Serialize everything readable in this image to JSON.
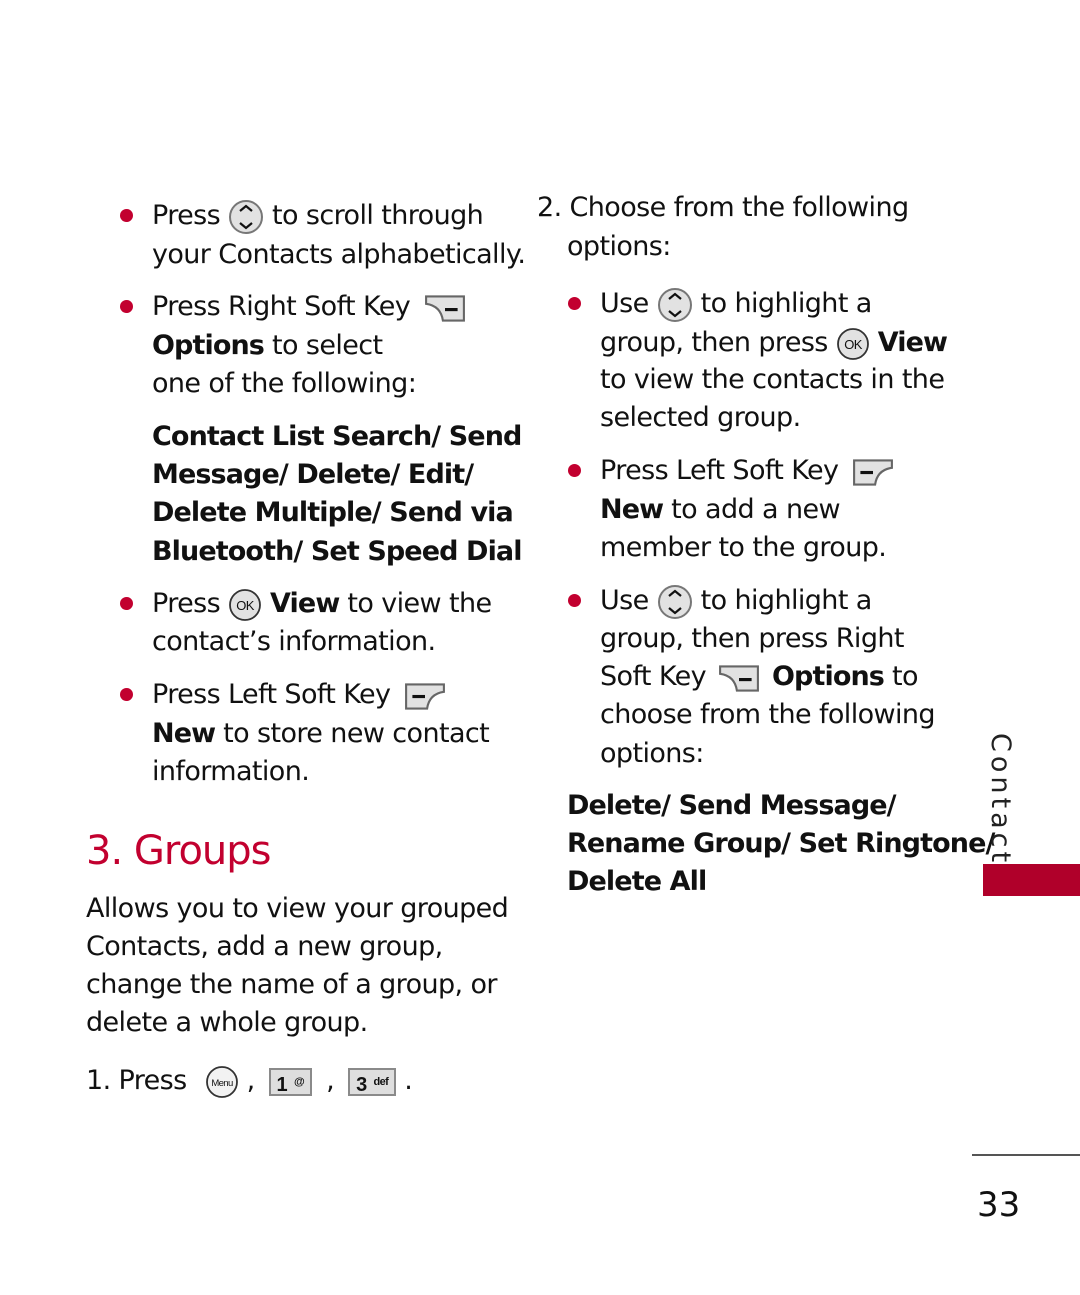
{
  "left_column": {
    "bullet1": {
      "line1_pre": "Press",
      "line1_post": "to scroll through",
      "line2": "your Contacts alphabetically.",
      "icon": "navigation-key-icon"
    },
    "bullet2": {
      "line1": "Press Right Soft Key",
      "icon": "right-soft-key-icon",
      "line2_bold": "Options",
      "line2_rest": " to select",
      "line3": "one of the following:"
    },
    "options_list": [
      "Contact List Search/ Send",
      "Message/ Delete/ Edit/",
      "Delete Multiple/ Send via",
      "Bluetooth/ Set Speed Dial"
    ],
    "bullet3": {
      "line1_pre": "Press",
      "icon": "ok-key-icon",
      "line1_bold": "View",
      "line1_rest": " to view the",
      "line2": "contact’s information."
    },
    "bullet4": {
      "line1": "Press Left Soft Key",
      "icon": "left-soft-key-icon",
      "line2_bold": "New",
      "line2_rest": " to store new contact",
      "line3": "information."
    }
  },
  "section": {
    "title": "3. Groups",
    "description": [
      "Allows you to view your grouped",
      "Contacts, add a new group,",
      "change the name of a group, or",
      "delete a whole group."
    ],
    "step1": {
      "label": "1. Press",
      "menu_key": "Menu",
      "key1_num": "1",
      "key1_sub": "@",
      "key3_num": "3",
      "key3_sub": "def",
      "sep": ",",
      "end": "."
    }
  },
  "right_column": {
    "step2": {
      "line1": "2. Choose from the following",
      "line2": "options:"
    },
    "bullet1": {
      "line1_pre": "Use",
      "line1_post": "to highlight a",
      "line2_pre": "group, then press",
      "line2_bold": "View",
      "line3": "to view the contacts in the",
      "line4": "selected group."
    },
    "bullet2": {
      "line1": "Press Left Soft Key",
      "line2_bold": "New",
      "line2_rest": " to add a new",
      "line3": "member to the group."
    },
    "bullet3": {
      "line1_pre": "Use",
      "line1_post": "to highlight a",
      "line2": "group, then press Right",
      "line3_pre": "Soft Key",
      "line3_bold": "Options",
      "line3_rest": " to",
      "line4": "choose from the following",
      "line5": "options:"
    },
    "options_list": [
      "Delete/ Send Message/",
      "Rename Group/ Set Ringtone/",
      "Delete All"
    ]
  },
  "side_tab": {
    "label": "Contacts",
    "color": "#b0002a"
  },
  "footer": {
    "page_number": "33"
  },
  "colors": {
    "accent": "#c2002f",
    "text": "#111111"
  }
}
